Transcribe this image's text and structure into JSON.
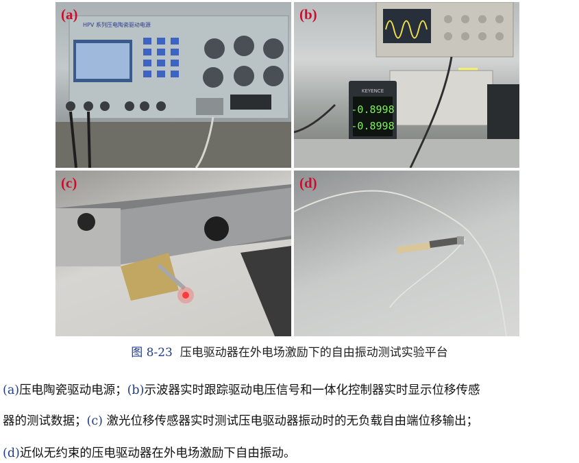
{
  "panels": {
    "a": {
      "label": "(a)",
      "panel_text": "HPV 系列压电陶瓷驱动电源"
    },
    "b": {
      "label": "(b)",
      "readout1": "-0.8998",
      "readout2": "-0.8998",
      "brand": "KEYENCE"
    },
    "c": {
      "label": "(c)"
    },
    "d": {
      "label": "(d)"
    }
  },
  "caption": {
    "figure_no": "图 8-23",
    "title": "压电驱动器在外电场激励下的自由振动测试实验平台"
  },
  "description": {
    "line1": [
      {
        "text": "(a)",
        "blue": true
      },
      {
        "text": "压电陶瓷驱动电源；",
        "blue": false
      },
      {
        "text": "(b)",
        "blue": true
      },
      {
        "text": "示波器实时跟踪驱动电压信号和一体化控制器实时显示位移传感",
        "blue": false
      }
    ],
    "line2": [
      {
        "text": "器的测试数据；",
        "blue": false
      },
      {
        "text": "(c)",
        "blue": true
      },
      {
        "text": " 激光位移传感器实时测试压电驱动器振动时的无负载自由端位移输出；",
        "blue": false
      }
    ],
    "line3": [
      {
        "text": "(d)",
        "blue": true
      },
      {
        "text": "近似无约束的压电驱动器在外电场激励下自由振动。",
        "blue": false
      }
    ]
  },
  "colors": {
    "label_red": "#c8102e",
    "ref_blue": "#1f3d8c"
  }
}
